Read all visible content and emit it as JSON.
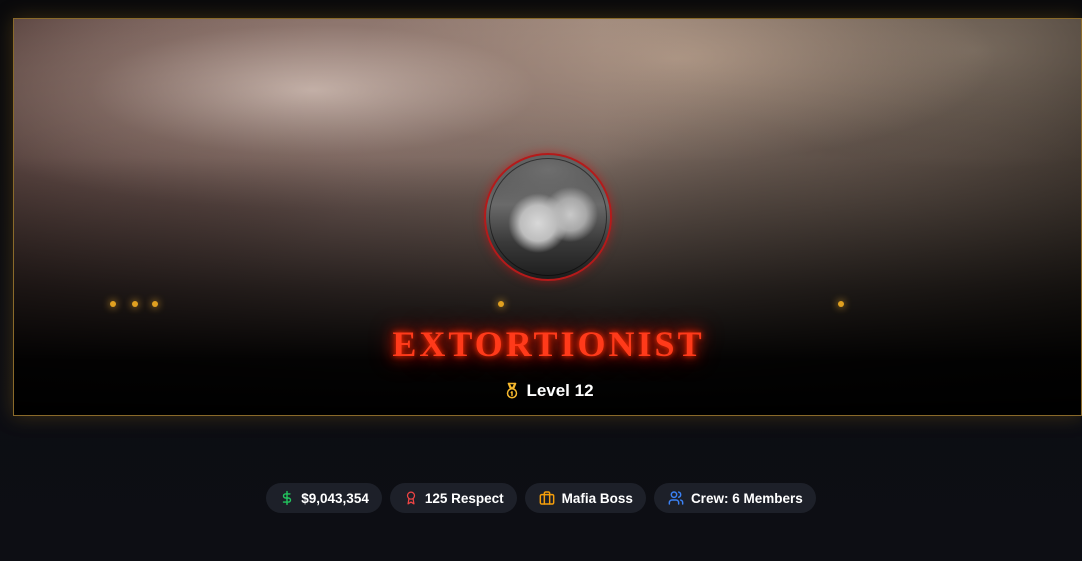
{
  "profile": {
    "title": "EXTORTIONIST",
    "level_label": "Level 12"
  },
  "stats": [
    {
      "icon": "dollar-icon",
      "color": "#22c55e",
      "label": "$9,043,354"
    },
    {
      "icon": "award-ribbon-icon",
      "color": "#ef4444",
      "label": "125 Respect"
    },
    {
      "icon": "briefcase-icon",
      "color": "#f59e0b",
      "label": "Mafia Boss"
    },
    {
      "icon": "users-icon",
      "color": "#3b82f6",
      "label": "Crew: 6 Members"
    }
  ],
  "colors": {
    "title": "#ff3a1a",
    "banner_border": "#8a6a2a",
    "avatar_border": "#b51a1a",
    "pill_bg": "#1d2029",
    "level_medal": "#f5b82e"
  }
}
